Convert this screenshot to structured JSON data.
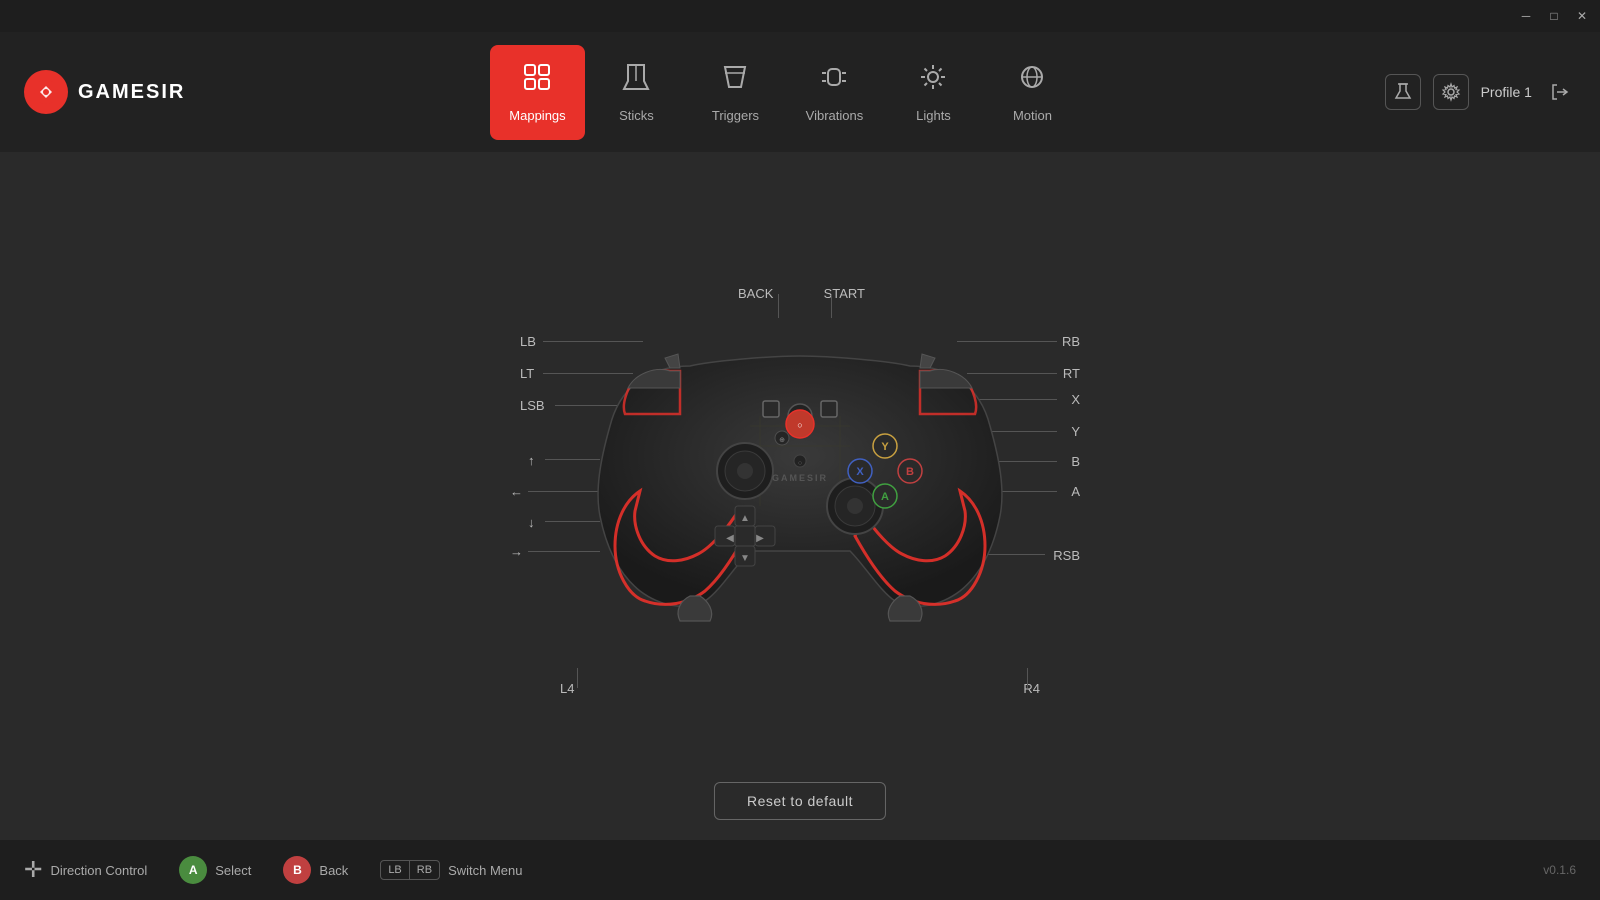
{
  "app": {
    "title": "GameSir",
    "logo_text": "GAMESIR",
    "version": "v0.1.6"
  },
  "titlebar": {
    "minimize": "—",
    "maximize": "□",
    "close": "✕"
  },
  "nav": {
    "tabs": [
      {
        "id": "mappings",
        "label": "Mappings",
        "icon": "⊞",
        "active": true
      },
      {
        "id": "sticks",
        "label": "Sticks",
        "icon": "◎",
        "active": false
      },
      {
        "id": "triggers",
        "label": "Triggers",
        "icon": "⌂",
        "active": false
      },
      {
        "id": "vibrations",
        "label": "Vibrations",
        "icon": "✦",
        "active": false
      },
      {
        "id": "lights",
        "label": "Lights",
        "icon": "☀",
        "active": false
      },
      {
        "id": "motion",
        "label": "Motion",
        "icon": "⟳",
        "active": false
      }
    ]
  },
  "profile": {
    "label": "Profile 1",
    "flask_icon": "⚗",
    "settings_icon": "⚙",
    "logout_icon": "⏏"
  },
  "controller_labels": {
    "lb": "LB",
    "lt": "LT",
    "lsb": "LSB",
    "up": "",
    "left": "",
    "down": "",
    "right": "",
    "rb": "RB",
    "rt": "RT",
    "x": "X",
    "y": "Y",
    "b": "B",
    "a": "A",
    "rsb": "RSB",
    "back": "BACK",
    "start": "START",
    "l4": "L4",
    "r4": "R4"
  },
  "reset_button": {
    "label": "Reset to default"
  },
  "bottom_bar": {
    "direction_control": "Direction Control",
    "select": "Select",
    "back": "Back",
    "switch_menu": "Switch Menu",
    "version": "v0.1.6",
    "btn_a": "A",
    "btn_b": "B",
    "lb_label": "LB",
    "rb_label": "RB"
  }
}
